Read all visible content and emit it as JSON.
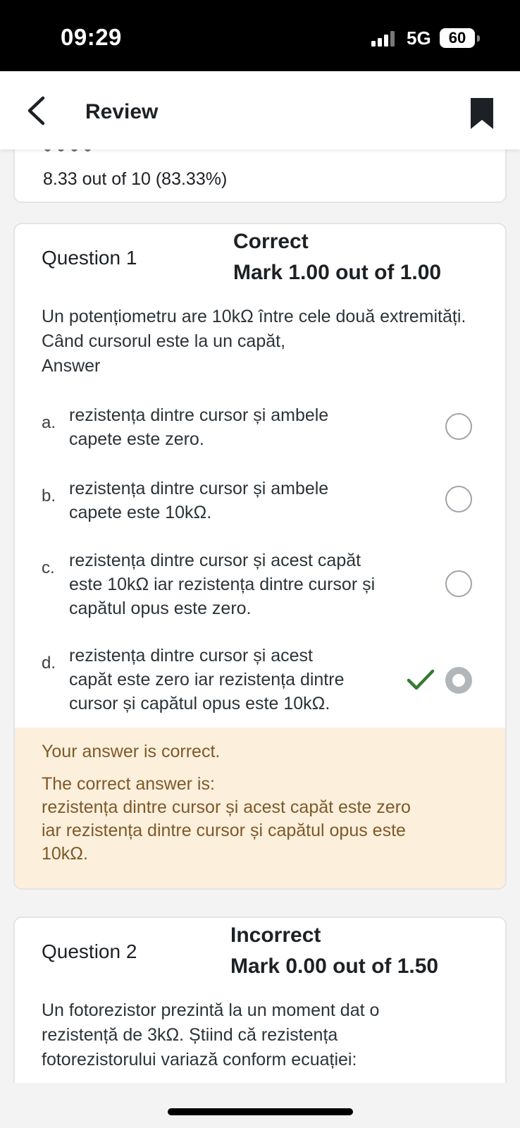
{
  "status_bar": {
    "time": "09:29",
    "network": "5G",
    "battery": "60"
  },
  "header": {
    "title": "Review",
    "back_icon": "chevron-left-icon",
    "bookmark_icon": "bookmark-icon"
  },
  "summary": {
    "grade": "8.33 out of 10 (83.33%)"
  },
  "questions": [
    {
      "number": "Question 1",
      "state": "Correct",
      "mark": "Mark 1.00 out of 1.00",
      "text": "Un potențiometru are 10kΩ între cele două extremități. Când cursorul este la un capăt,",
      "answer_label": "Answer",
      "options": [
        {
          "letter": "a.",
          "line1": "rezistența dintre cursor și ambele",
          "line2": "capete este zero.",
          "line3": "",
          "selected": false
        },
        {
          "letter": "b.",
          "line1": "rezistența dintre cursor și ambele",
          "line2": "capete este 10kΩ.",
          "line3": "",
          "selected": false
        },
        {
          "letter": "c.",
          "line1": "rezistența dintre cursor și acest capăt",
          "line2": "este 10kΩ iar rezistența dintre cursor și",
          "line3": "capătul opus este zero.",
          "selected": false
        },
        {
          "letter": "d.",
          "line1": "rezistența dintre cursor și acest",
          "line2": "capăt este zero iar rezistența dintre",
          "line3": "cursor și capătul opus este 10kΩ.",
          "selected": true
        }
      ],
      "feedback": {
        "result": "Your answer is correct.",
        "correct_label": "The correct answer is:",
        "correct_line1": "rezistența dintre cursor și acest capăt este zero",
        "correct_line2": "iar rezistența dintre cursor și capătul opus este",
        "correct_line3": "10kΩ."
      }
    },
    {
      "number": "Question 2",
      "state": "Incorrect",
      "mark": "Mark 0.00 out of 1.50",
      "text_line1": "Un fotorezistor prezintă la un moment dat o",
      "text_line2": "rezistență de 3kΩ. Știind că rezistența",
      "text_line3": "fotorezistorului variază conform ecuației:"
    }
  ],
  "colors": {
    "feedback_bg": "#fcefdc",
    "feedback_text": "#7d5a29",
    "correct_check": "#357a32"
  }
}
